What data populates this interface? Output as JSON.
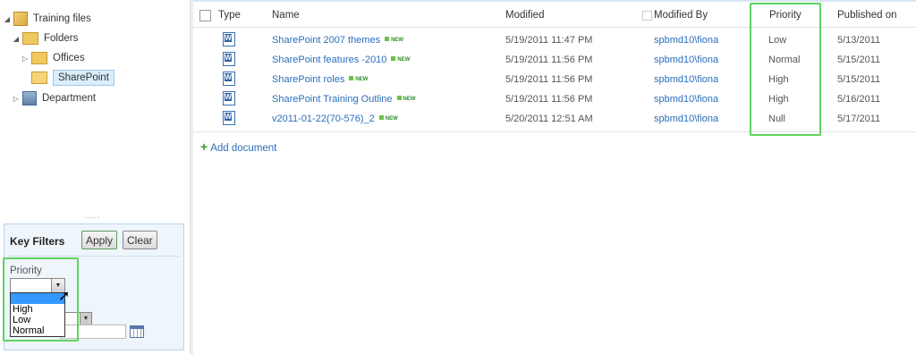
{
  "tree": {
    "root": "Training files",
    "folders": "Folders",
    "offices": "Offices",
    "sharepoint": "SharePoint",
    "department": "Department"
  },
  "key_filters": {
    "title": "Key Filters",
    "apply": "Apply",
    "clear": "Clear",
    "priority_label": "Priority",
    "priority_options": [
      "",
      "High",
      "Low",
      "Normal"
    ]
  },
  "list": {
    "headers": {
      "type": "Type",
      "name": "Name",
      "modified": "Modified",
      "modified_by": "Modified By",
      "priority": "Priority",
      "published_on": "Published on"
    },
    "new_label": "NEW",
    "rows": [
      {
        "name": "SharePoint 2007 themes",
        "modified": "5/19/2011 11:47 PM",
        "modified_by": "spbmd10\\fiona",
        "priority": "Low",
        "published": "5/13/2011"
      },
      {
        "name": "SharePoint features -2010",
        "modified": "5/19/2011 11:56 PM",
        "modified_by": "spbmd10\\fiona",
        "priority": "Normal",
        "published": "5/15/2011"
      },
      {
        "name": "SharePoint roles",
        "modified": "5/19/2011 11:56 PM",
        "modified_by": "spbmd10\\fiona",
        "priority": "High",
        "published": "5/15/2011"
      },
      {
        "name": "SharePoint Training Outline",
        "modified": "5/19/2011 11:56 PM",
        "modified_by": "spbmd10\\fiona",
        "priority": "High",
        "published": "5/16/2011"
      },
      {
        "name": "v2011-01-22(70-576)_2",
        "modified": "5/20/2011 12:51 AM",
        "modified_by": "spbmd10\\fiona",
        "priority": "Null",
        "published": "5/17/2011"
      }
    ],
    "add_document": "Add document"
  },
  "colors": {
    "link": "#2a6ebc",
    "highlight": "#5fd35f",
    "filter_panel": "#eef5fb"
  }
}
